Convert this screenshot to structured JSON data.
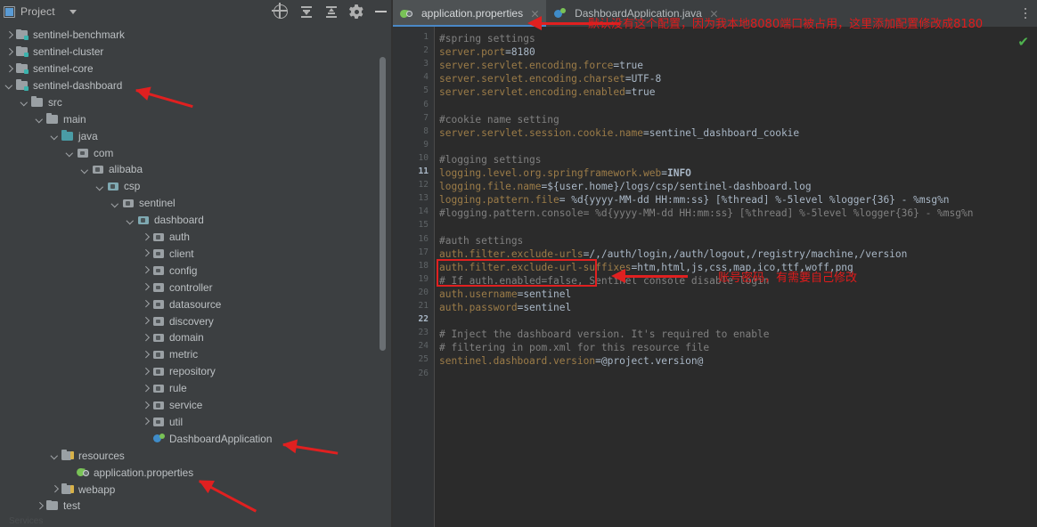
{
  "project_panel": {
    "title": "Project",
    "window_icon": "project-window-icon",
    "dropdown_icon": "chevron-down-icon",
    "toolbar": [
      {
        "name": "locate-icon",
        "label": "Select Opened File"
      },
      {
        "name": "expand-all-icon",
        "label": "Expand All"
      },
      {
        "name": "collapse-all-icon",
        "label": "Collapse All"
      },
      {
        "name": "gear-icon",
        "label": "Settings"
      },
      {
        "name": "minimize-icon",
        "label": "Hide"
      }
    ],
    "tree": [
      {
        "label": "sentinel-benchmark",
        "depth": 1,
        "state": "collapsed",
        "icon": "module-folder-icon"
      },
      {
        "label": "sentinel-cluster",
        "depth": 1,
        "state": "collapsed",
        "icon": "module-folder-icon"
      },
      {
        "label": "sentinel-core",
        "depth": 1,
        "state": "collapsed",
        "icon": "module-folder-icon"
      },
      {
        "label": "sentinel-dashboard",
        "depth": 1,
        "state": "expanded",
        "icon": "module-folder-icon"
      },
      {
        "label": "src",
        "depth": 2,
        "state": "expanded",
        "icon": "folder-icon"
      },
      {
        "label": "main",
        "depth": 3,
        "state": "expanded",
        "icon": "folder-icon"
      },
      {
        "label": "java",
        "depth": 4,
        "state": "expanded",
        "icon": "source-root-folder-icon"
      },
      {
        "label": "com",
        "depth": 5,
        "state": "expanded",
        "icon": "package-icon"
      },
      {
        "label": "alibaba",
        "depth": 6,
        "state": "expanded",
        "icon": "package-icon"
      },
      {
        "label": "csp",
        "depth": 7,
        "state": "expanded",
        "icon": "package-icon"
      },
      {
        "label": "sentinel",
        "depth": 8,
        "state": "expanded",
        "icon": "package-icon"
      },
      {
        "label": "dashboard",
        "depth": 9,
        "state": "expanded",
        "icon": "package-icon"
      },
      {
        "label": "auth",
        "depth": 10,
        "state": "collapsed",
        "icon": "package-icon"
      },
      {
        "label": "client",
        "depth": 10,
        "state": "collapsed",
        "icon": "package-icon"
      },
      {
        "label": "config",
        "depth": 10,
        "state": "collapsed",
        "icon": "package-icon"
      },
      {
        "label": "controller",
        "depth": 10,
        "state": "collapsed",
        "icon": "package-icon"
      },
      {
        "label": "datasource",
        "depth": 10,
        "state": "collapsed",
        "icon": "package-icon"
      },
      {
        "label": "discovery",
        "depth": 10,
        "state": "collapsed",
        "icon": "package-icon"
      },
      {
        "label": "domain",
        "depth": 10,
        "state": "collapsed",
        "icon": "package-icon"
      },
      {
        "label": "metric",
        "depth": 10,
        "state": "collapsed",
        "icon": "package-icon"
      },
      {
        "label": "repository",
        "depth": 10,
        "state": "collapsed",
        "icon": "package-icon"
      },
      {
        "label": "rule",
        "depth": 10,
        "state": "collapsed",
        "icon": "package-icon"
      },
      {
        "label": "service",
        "depth": 10,
        "state": "collapsed",
        "icon": "package-icon"
      },
      {
        "label": "util",
        "depth": 10,
        "state": "collapsed",
        "icon": "package-icon"
      },
      {
        "label": "DashboardApplication",
        "depth": 10,
        "state": "leaf",
        "icon": "spring-boot-class-icon"
      },
      {
        "label": "resources",
        "depth": 4,
        "state": "expanded",
        "icon": "resources-folder-icon"
      },
      {
        "label": "application.properties",
        "depth": 5,
        "state": "leaf",
        "icon": "spring-properties-file-icon"
      },
      {
        "label": "webapp",
        "depth": 4,
        "state": "collapsed",
        "icon": "resources-folder-icon"
      },
      {
        "label": "test",
        "depth": 3,
        "state": "collapsed",
        "icon": "folder-icon"
      }
    ]
  },
  "status_bar": {
    "text": "Services"
  },
  "editor": {
    "tabs": [
      {
        "label": "application.properties",
        "icon": "spring-properties-file-icon",
        "active": true,
        "close_icon": "close-icon"
      },
      {
        "label": "DashboardApplication.java",
        "icon": "spring-boot-class-icon",
        "active": false,
        "close_icon": "close-icon"
      }
    ],
    "tab_overflow_icon": "more-vertical-icon",
    "inspection_status_icon": "check-mark-ok-icon",
    "inspection_status_glyph": "✔",
    "line_numbers": [
      1,
      2,
      3,
      4,
      5,
      6,
      7,
      8,
      9,
      10,
      11,
      12,
      13,
      14,
      15,
      16,
      17,
      18,
      19,
      20,
      21,
      22,
      23,
      24,
      25,
      26
    ],
    "highlighted_line_numbers": [
      11,
      22
    ],
    "lines": [
      {
        "n": 1,
        "text": "#spring settings",
        "type": "comment"
      },
      {
        "n": 2,
        "text": "server.port=8180",
        "type": "prop",
        "key": "server.port",
        "value": "8180"
      },
      {
        "n": 3,
        "text": "server.servlet.encoding.force=true",
        "type": "prop",
        "key": "server.servlet.encoding.force",
        "value": "true"
      },
      {
        "n": 4,
        "text": "server.servlet.encoding.charset=UTF-8",
        "type": "prop",
        "key": "server.servlet.encoding.charset",
        "value": "UTF-8"
      },
      {
        "n": 5,
        "text": "server.servlet.encoding.enabled=true",
        "type": "prop",
        "key": "server.servlet.encoding.enabled",
        "value": "true"
      },
      {
        "n": 6,
        "text": "",
        "type": "blank"
      },
      {
        "n": 7,
        "text": "#cookie name setting",
        "type": "comment"
      },
      {
        "n": 8,
        "text": "server.servlet.session.cookie.name=sentinel_dashboard_cookie",
        "type": "prop",
        "key": "server.servlet.session.cookie.name",
        "value": "sentinel_dashboard_cookie"
      },
      {
        "n": 9,
        "text": "",
        "type": "blank"
      },
      {
        "n": 10,
        "text": "#logging settings",
        "type": "comment"
      },
      {
        "n": 11,
        "text": "logging.level.org.springframework.web=INFO",
        "type": "prop",
        "key": "logging.level.org.springframework.web",
        "value": "INFO"
      },
      {
        "n": 12,
        "text": "logging.file.name=${user.home}/logs/csp/sentinel-dashboard.log",
        "type": "prop",
        "key": "logging.file.name",
        "value": "${user.home}/logs/csp/sentinel-dashboard.log"
      },
      {
        "n": 13,
        "text": "logging.pattern.file= %d{yyyy-MM-dd HH:mm:ss} [%thread] %-5level %logger{36} - %msg%n",
        "type": "prop",
        "key": "logging.pattern.file",
        "value": " %d{yyyy-MM-dd HH:mm:ss} [%thread] %-5level %logger{36} - %msg%n"
      },
      {
        "n": 14,
        "text": "#logging.pattern.console= %d{yyyy-MM-dd HH:mm:ss} [%thread] %-5level %logger{36} - %msg%n",
        "type": "comment"
      },
      {
        "n": 15,
        "text": "",
        "type": "blank"
      },
      {
        "n": 16,
        "text": "#auth settings",
        "type": "comment"
      },
      {
        "n": 17,
        "text": "auth.filter.exclude-urls=/,/auth/login,/auth/logout,/registry/machine,/version",
        "type": "prop",
        "key": "auth.filter.exclude-urls",
        "value": "/,/auth/login,/auth/logout,/registry/machine,/version"
      },
      {
        "n": 18,
        "text": "auth.filter.exclude-url-suffixes=htm,html,js,css,map,ico,ttf,woff,png",
        "type": "prop",
        "key": "auth.filter.exclude-url-suffixes",
        "value": "htm,html,js,css,map,ico,ttf,woff,png"
      },
      {
        "n": 19,
        "text": "# If auth.enabled=false, Sentinel console disable login",
        "type": "comment"
      },
      {
        "n": 20,
        "text": "auth.username=sentinel",
        "type": "prop",
        "key": "auth.username",
        "value": "sentinel"
      },
      {
        "n": 21,
        "text": "auth.password=sentinel",
        "type": "prop",
        "key": "auth.password",
        "value": "sentinel"
      },
      {
        "n": 22,
        "text": "",
        "type": "blank"
      },
      {
        "n": 23,
        "text": "# Inject the dashboard version. It's required to enable",
        "type": "comment"
      },
      {
        "n": 24,
        "text": "# filtering in pom.xml for this resource file",
        "type": "comment"
      },
      {
        "n": 25,
        "text": "sentinel.dashboard.version=@project.version@",
        "type": "prop",
        "key": "sentinel.dashboard.version",
        "value": "@project.version@"
      },
      {
        "n": 26,
        "text": "",
        "type": "blank"
      }
    ]
  },
  "annotations": [
    {
      "id": "anno-port",
      "text": "默认没有这个配置，因为我本地8080端口被占用，这里添加配置修改成8180",
      "color": "#e01b1b"
    },
    {
      "id": "anno-auth",
      "text": "账号密码，有需要自己修改",
      "color": "#e01b1b"
    }
  ],
  "colors": {
    "panel_bg": "#3c3f41",
    "editor_bg": "#2b2b2b",
    "gutter_bg": "#313335",
    "tab_active_bg": "#4e5254",
    "tab_underline": "#4a88c7",
    "annotation_red": "#e02020",
    "ok_green": "#4fb34f",
    "prop_key": "#9c7c48",
    "prop_value": "#6a8759",
    "comment": "#808080"
  }
}
